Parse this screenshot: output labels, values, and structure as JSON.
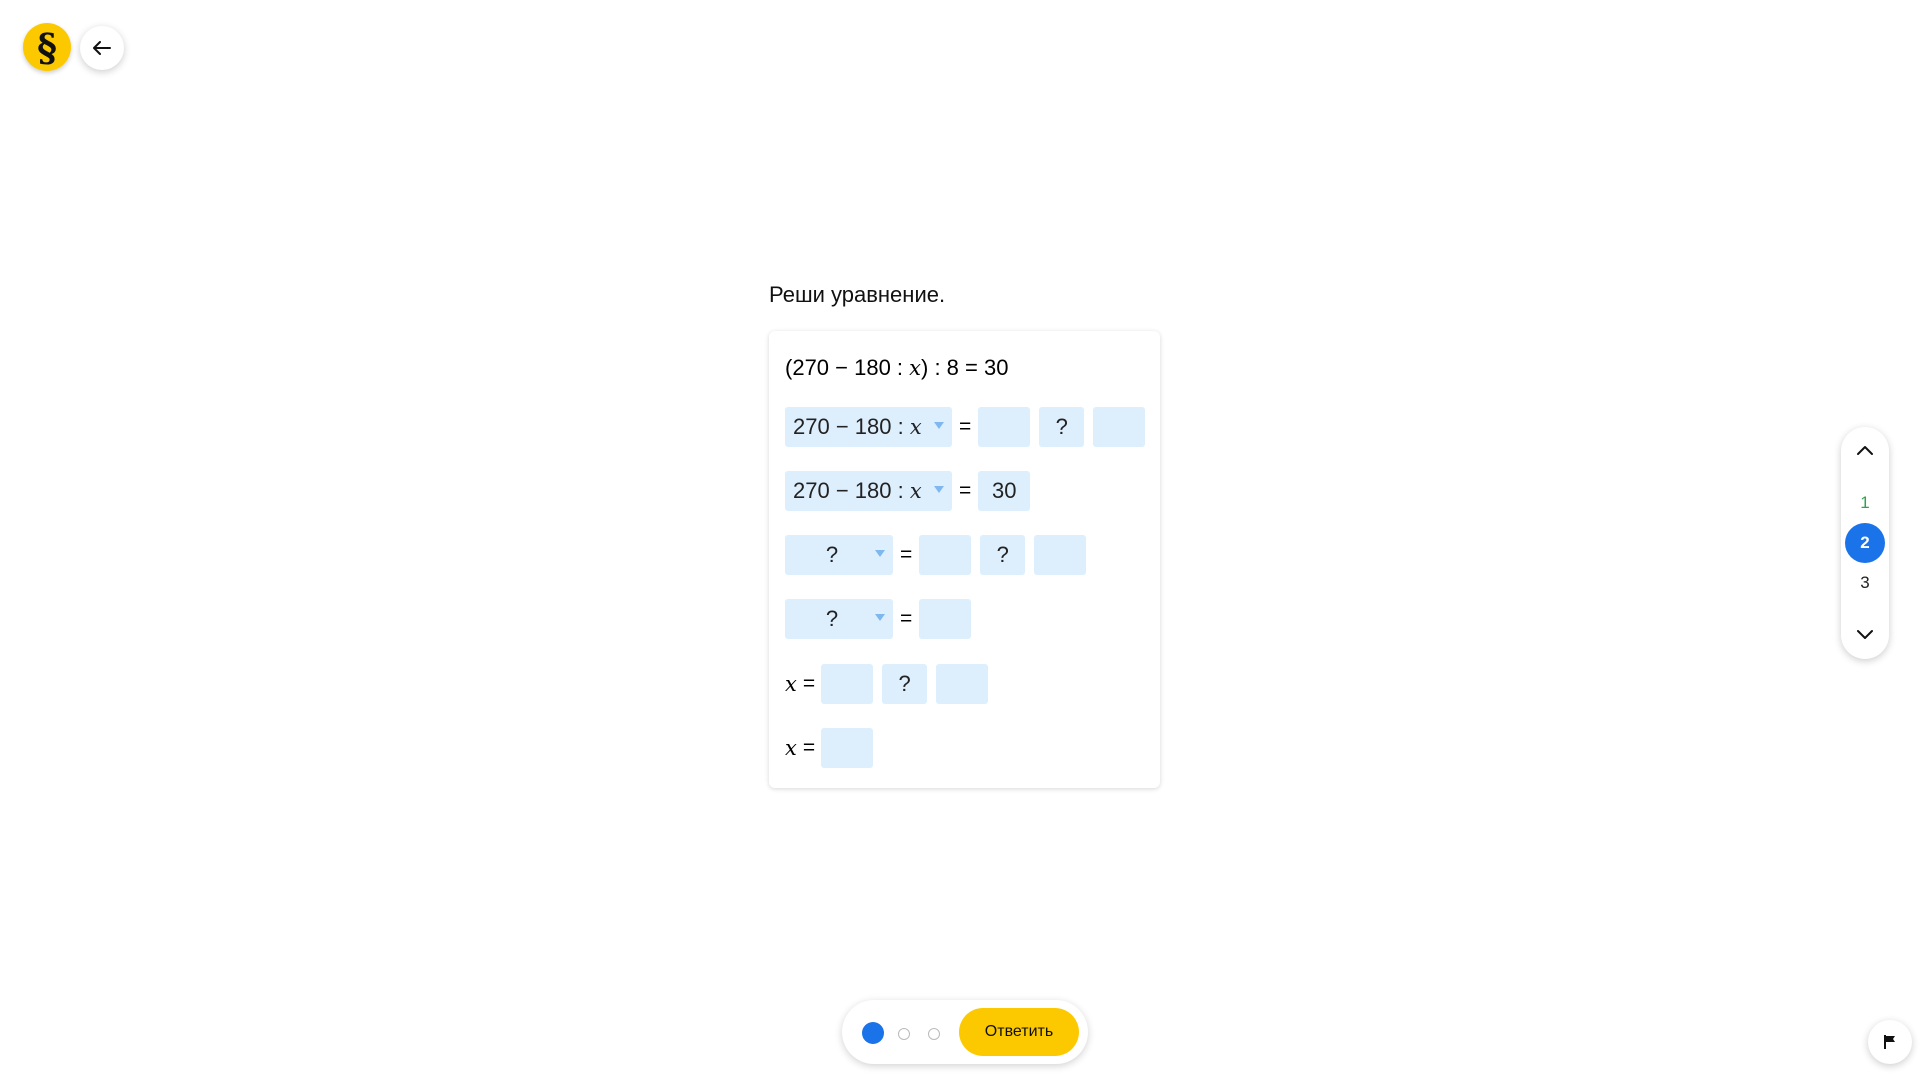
{
  "header": {
    "logo_glyph": "§",
    "logo_color": "#fcc900"
  },
  "task": {
    "title": "Реши уравнение.",
    "equation": {
      "open_paren": "(",
      "part1": "270 − 180 : ",
      "var": "x",
      "part2": ") : 8 = 30"
    },
    "rows": [
      {
        "select_pre": "270 − 180 : ",
        "select_var": "x",
        "eq": "=",
        "input1": "",
        "op": "?",
        "input2": ""
      },
      {
        "select_pre": "270 − 180 : ",
        "select_var": "x",
        "eq": "=",
        "value": "30"
      },
      {
        "select": "?",
        "eq": "=",
        "input1": "",
        "op": "?",
        "input2": ""
      },
      {
        "select": "?",
        "eq": "=",
        "input1": ""
      },
      {
        "label_var": "x",
        "eq": "=",
        "input1": "",
        "op": "?",
        "input2": ""
      },
      {
        "label_var": "x",
        "eq": "=",
        "input1": ""
      }
    ]
  },
  "side_nav": {
    "pages": [
      {
        "label": "1",
        "state": "done"
      },
      {
        "label": "2",
        "state": "current"
      },
      {
        "label": "3",
        "state": "pending"
      }
    ],
    "up_icon": "chevron-up-icon",
    "down_icon": "chevron-down-icon"
  },
  "bottom_bar": {
    "answer_label": "Ответить",
    "progress_dots": [
      "current",
      "empty",
      "empty"
    ]
  },
  "colors": {
    "accent_yellow": "#fcc900",
    "accent_blue": "#1a73e8",
    "input_bg": "#ddeefd",
    "done_green": "#2da44e"
  }
}
